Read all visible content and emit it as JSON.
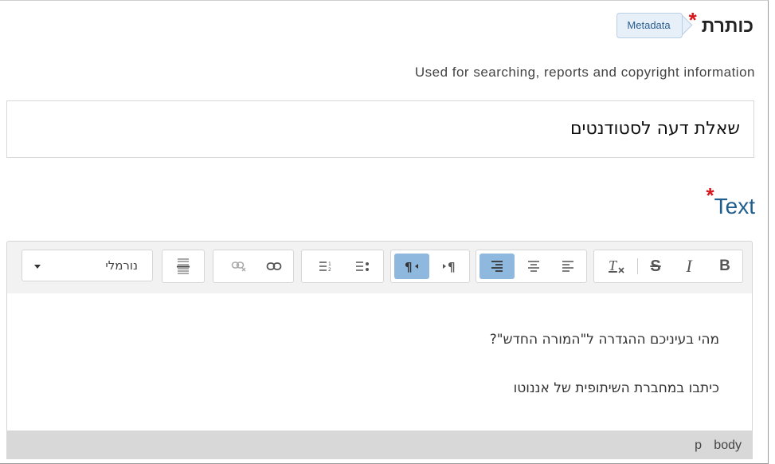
{
  "title_field": {
    "label": "כותרת",
    "required_mark": "*",
    "metadata_badge": "Metadata",
    "description": "Used for searching, reports and copyright information",
    "value": "שאלת דעה לסטודנטים"
  },
  "text_field": {
    "label": "Text",
    "required_mark": "*"
  },
  "toolbar": {
    "format_select_value": "נורמלי",
    "buttons": [
      "bold-icon",
      "italic-icon",
      "strikethrough-icon",
      "remove-format-icon",
      "align-left-icon",
      "align-center-icon",
      "align-right-icon",
      "ltr-icon",
      "rtl-icon",
      "bulleted-list-icon",
      "numbered-list-icon",
      "link-icon",
      "unlink-icon",
      "horizontal-rule-icon"
    ],
    "active_buttons": [
      "align-right-icon",
      "rtl-icon"
    ],
    "active_color": "#8fb8de"
  },
  "editor": {
    "paragraphs": [
      "מהי בעיניכם ההגדרה ל\"המורה החדש\"?",
      "כיתבו במחברת השיתופית של אננוטו"
    ]
  },
  "statusbar": {
    "path": [
      "body",
      "p"
    ]
  },
  "colors": {
    "required": "#d8151b",
    "label_blue": "#1f5d8c"
  }
}
